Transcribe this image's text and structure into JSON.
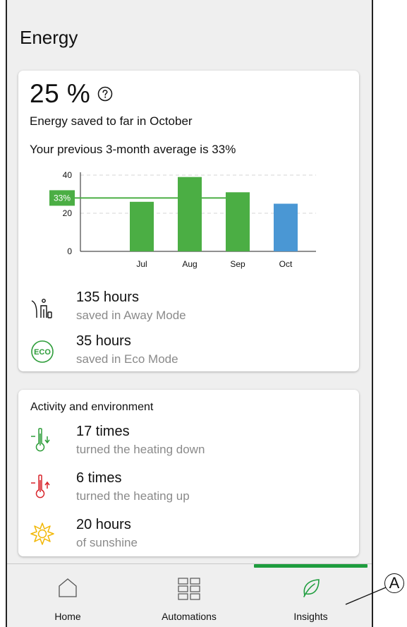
{
  "screen": {
    "title": "Energy"
  },
  "energy_card": {
    "percent_value": "25 %",
    "saved_text": "Energy saved to far in October",
    "previous_text": "Your previous 3-month average is 33%",
    "stats": [
      {
        "icon": "away-mode-icon",
        "value": "135 hours",
        "label": "saved in Away Mode"
      },
      {
        "icon": "eco-icon",
        "value": "35 hours",
        "label": "saved in Eco Mode"
      }
    ]
  },
  "chart_data": {
    "type": "bar",
    "categories": [
      "Jul",
      "Aug",
      "Sep",
      "Oct"
    ],
    "values": [
      26,
      39,
      31,
      25
    ],
    "bar_colors": [
      "#4bae44",
      "#4bae44",
      "#4bae44",
      "#4a97d4"
    ],
    "y_ticks": [
      "0",
      "20",
      "40"
    ],
    "ylim": [
      0,
      40
    ],
    "reference": {
      "label": "33%",
      "value": 28,
      "color": "#4bae44"
    },
    "grid": true
  },
  "activity_card": {
    "title": "Activity and environment",
    "stats": [
      {
        "icon": "thermometer-down-icon",
        "value": "17 times",
        "label": "turned the heating down"
      },
      {
        "icon": "thermometer-up-icon",
        "value": "6 times",
        "label": "turned the heating up"
      },
      {
        "icon": "sunshine-icon",
        "value": "20 hours",
        "label": "of sunshine"
      }
    ]
  },
  "tabbar": {
    "tabs": [
      {
        "label": "Home",
        "icon": "house-icon"
      },
      {
        "label": "Automations",
        "icon": "grid-icon"
      },
      {
        "label": "Insights",
        "icon": "leaf-icon",
        "active": true
      }
    ]
  },
  "callout": {
    "label": "A"
  },
  "colors": {
    "accent_green": "#1e9d3e",
    "bar_green": "#4bae44",
    "bar_blue": "#4a97d4",
    "heating_down": "#2e9d3a",
    "heating_up": "#d8232a",
    "sun": "#f2b705"
  }
}
